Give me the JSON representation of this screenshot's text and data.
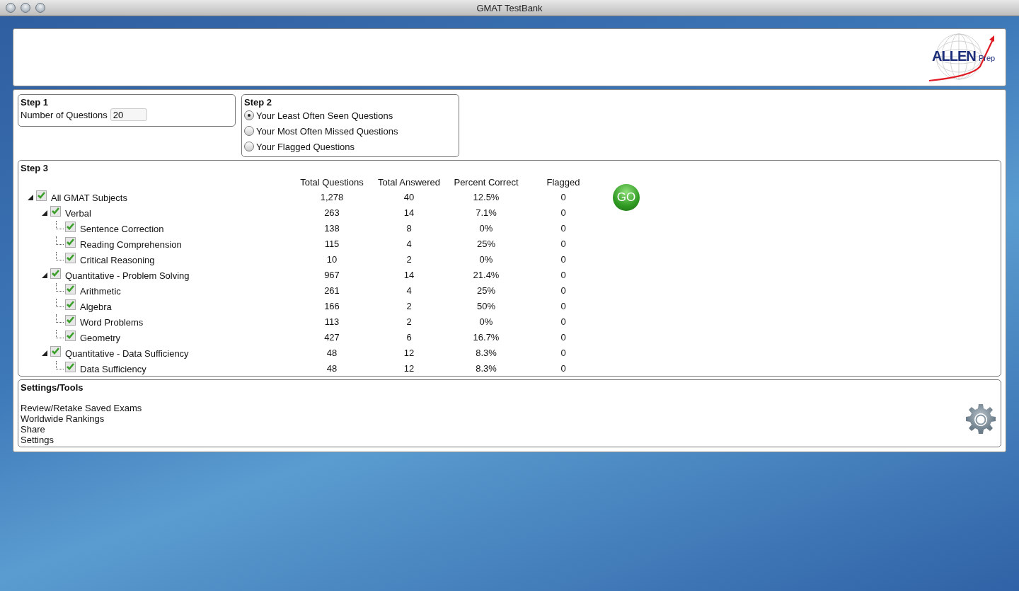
{
  "window": {
    "title": "GMAT TestBank"
  },
  "logo": {
    "brand": "ALLEN",
    "suffix": "Prep"
  },
  "step1": {
    "title": "Step 1",
    "label": "Number of Questions",
    "value": "20"
  },
  "step2": {
    "title": "Step 2",
    "options": [
      {
        "label": "Your Least Often Seen Questions",
        "selected": true
      },
      {
        "label": "Your Most Often Missed Questions",
        "selected": false
      },
      {
        "label": "Your Flagged Questions",
        "selected": false
      }
    ]
  },
  "step3": {
    "title": "Step 3",
    "columns": [
      "Total Questions",
      "Total Answered",
      "Percent Correct",
      "Flagged"
    ],
    "go_button": "GO",
    "tree": [
      {
        "label": "All GMAT Subjects",
        "checked": true,
        "expanded": true,
        "cells": [
          "1,278",
          "40",
          "12.5%",
          "0"
        ],
        "children": [
          {
            "label": "Verbal",
            "checked": true,
            "expanded": true,
            "cells": [
              "263",
              "14",
              "7.1%",
              "0"
            ],
            "children": [
              {
                "label": "Sentence Correction",
                "checked": true,
                "cells": [
                  "138",
                  "8",
                  "0%",
                  "0"
                ]
              },
              {
                "label": "Reading Comprehension",
                "checked": true,
                "cells": [
                  "115",
                  "4",
                  "25%",
                  "0"
                ]
              },
              {
                "label": "Critical Reasoning",
                "checked": true,
                "cells": [
                  "10",
                  "2",
                  "0%",
                  "0"
                ]
              }
            ]
          },
          {
            "label": "Quantitative - Problem Solving",
            "checked": true,
            "expanded": true,
            "cells": [
              "967",
              "14",
              "21.4%",
              "0"
            ],
            "children": [
              {
                "label": "Arithmetic",
                "checked": true,
                "cells": [
                  "261",
                  "4",
                  "25%",
                  "0"
                ]
              },
              {
                "label": "Algebra",
                "checked": true,
                "cells": [
                  "166",
                  "2",
                  "50%",
                  "0"
                ]
              },
              {
                "label": "Word Problems",
                "checked": true,
                "cells": [
                  "113",
                  "2",
                  "0%",
                  "0"
                ]
              },
              {
                "label": "Geometry",
                "checked": true,
                "cells": [
                  "427",
                  "6",
                  "16.7%",
                  "0"
                ]
              }
            ]
          },
          {
            "label": "Quantitative - Data Sufficiency",
            "checked": true,
            "expanded": true,
            "cells": [
              "48",
              "12",
              "8.3%",
              "0"
            ],
            "children": [
              {
                "label": "Data Sufficiency",
                "checked": true,
                "cells": [
                  "48",
                  "12",
                  "8.3%",
                  "0"
                ]
              }
            ]
          }
        ]
      }
    ]
  },
  "settings": {
    "title": "Settings/Tools",
    "links": [
      "Review/Retake Saved Exams",
      "Worldwide Rankings",
      "Share",
      "Settings"
    ]
  }
}
